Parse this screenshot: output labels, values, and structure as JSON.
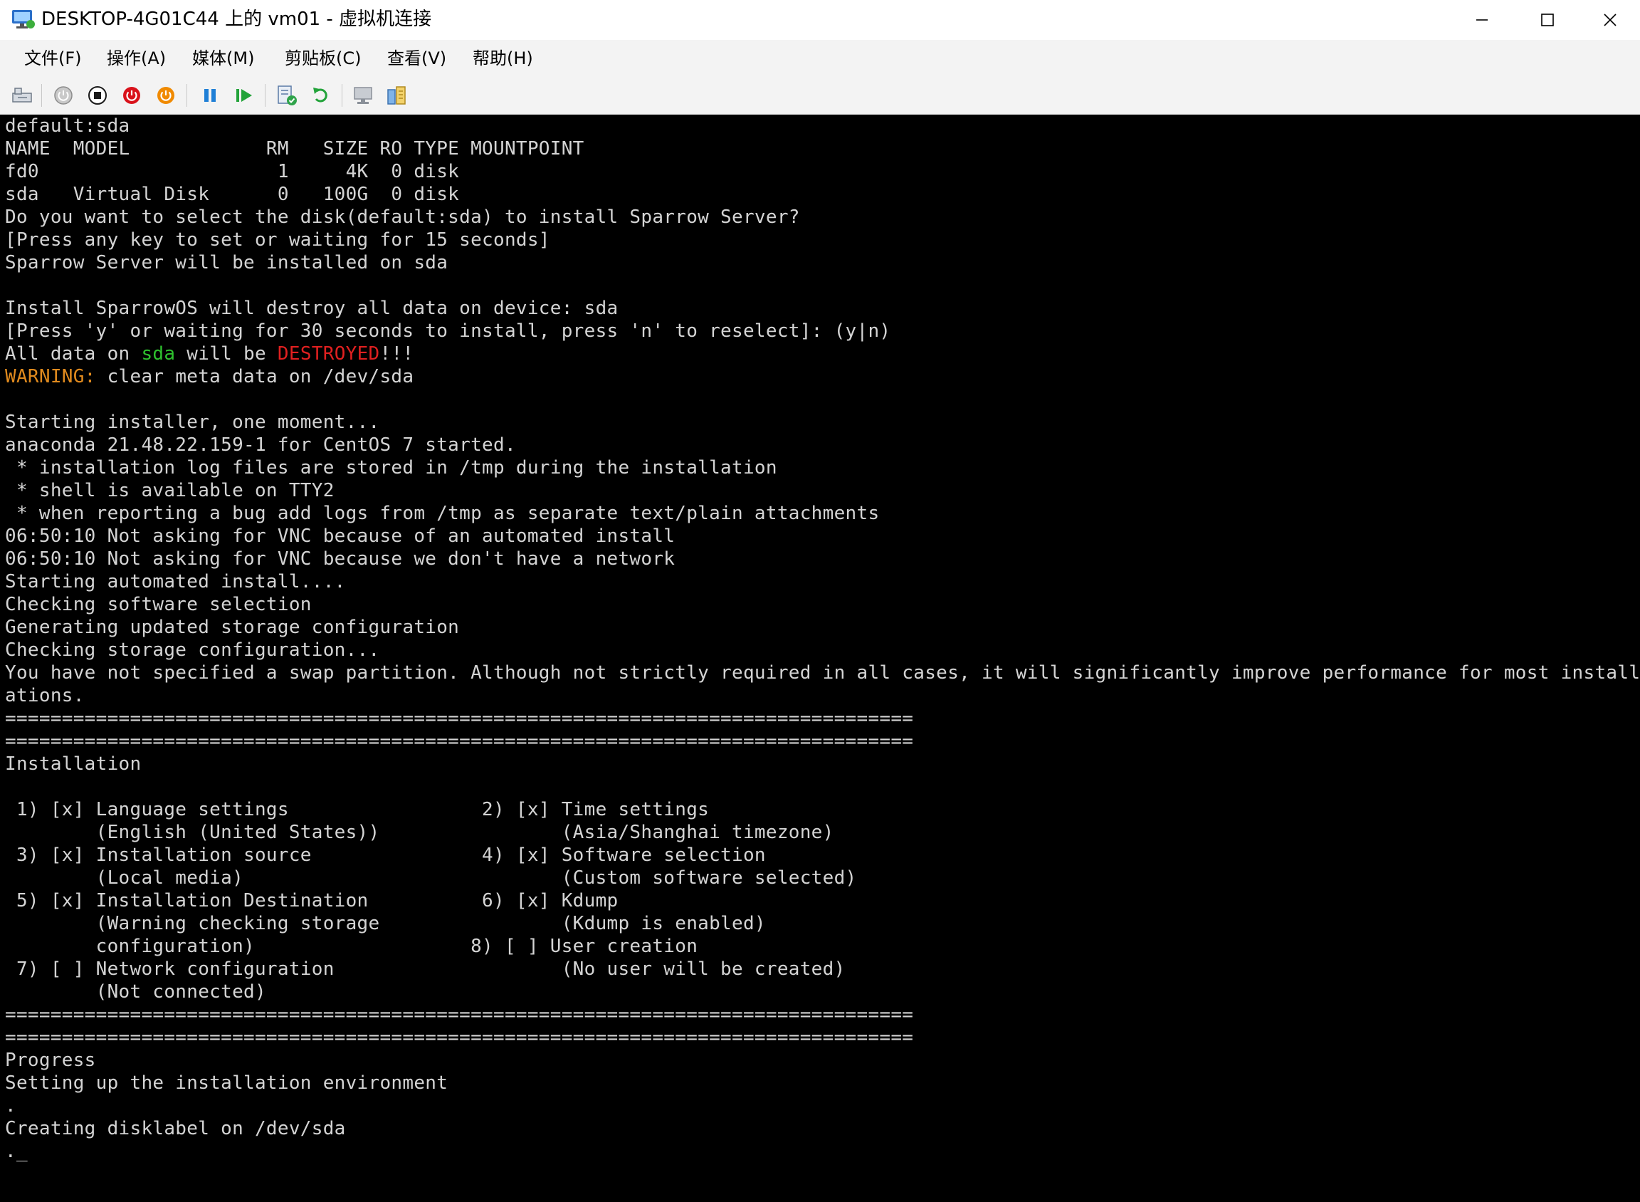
{
  "window": {
    "title": "DESKTOP-4G01C44 上的 vm01 - 虚拟机连接"
  },
  "menu": {
    "file": "文件(F)",
    "action": "操作(A)",
    "media": "媒体(M)",
    "clipboard": "剪贴板(C)",
    "view": "查看(V)",
    "help": "帮助(H)"
  },
  "toolbar": {
    "icons": [
      "ctrl-alt-del-icon",
      "start-icon",
      "turn-off-icon",
      "shutdown-icon",
      "power-icon",
      "pause-icon",
      "resume-icon",
      "checkpoint-icon",
      "revert-icon",
      "enhanced-session-icon",
      "share-icon"
    ]
  },
  "colors": {
    "console_text": "#d4d4d4",
    "green": "#2ec22e",
    "red": "#e02020",
    "orange": "#e08a1e"
  },
  "console": {
    "l01": "default:sda",
    "l02": "NAME  MODEL            RM   SIZE RO TYPE MOUNTPOINT",
    "l03": "fd0                     1     4K  0 disk",
    "l04": "sda   Virtual Disk      0   100G  0 disk",
    "l05": "Do you want to select the disk(default:sda) to install Sparrow Server?",
    "l06": "[Press any key to set or waiting for 15 seconds]",
    "l07": "Sparrow Server will be installed on sda",
    "l08": "",
    "l09": "Install SparrowOS will destroy all data on device: sda",
    "l10": "[Press 'y' or waiting for 30 seconds to install, press 'n' to reselect]: (y|n)",
    "l11a": "All data on ",
    "l11b": "sda",
    "l11c": " will be ",
    "l11d": "DESTROYED",
    "l11e": "!!!",
    "l12a": "WARNING:",
    "l12b": " clear meta data on /dev/sda",
    "l13": "",
    "l14": "Starting installer, one moment...",
    "l15": "anaconda 21.48.22.159-1 for CentOS 7 started.",
    "l16": " * installation log files are stored in /tmp during the installation",
    "l17": " * shell is available on TTY2",
    "l18": " * when reporting a bug add logs from /tmp as separate text/plain attachments",
    "l19": "06:50:10 Not asking for VNC because of an automated install",
    "l20": "06:50:10 Not asking for VNC because we don't have a network",
    "l21": "Starting automated install....",
    "l22": "Checking software selection",
    "l23": "Generating updated storage configuration",
    "l24": "Checking storage configuration...",
    "l25": "You have not specified a swap partition. Although not strictly required in all cases, it will significantly improve performance for most install",
    "l26": "ations.",
    "l27": "================================================================================",
    "l28": "================================================================================",
    "l29": "Installation",
    "l30": "",
    "l31": " 1) [x] Language settings                 2) [x] Time settings",
    "l32": "        (English (United States))                (Asia/Shanghai timezone)",
    "l33": " 3) [x] Installation source               4) [x] Software selection",
    "l34": "        (Local media)                            (Custom software selected)",
    "l35": " 5) [x] Installation Destination          6) [x] Kdump",
    "l36": "        (Warning checking storage                (Kdump is enabled)",
    "l37": "        configuration)                   8) [ ] User creation",
    "l38": " 7) [ ] Network configuration                    (No user will be created)",
    "l39": "        (Not connected)",
    "l40": "================================================================================",
    "l41": "================================================================================",
    "l42": "Progress",
    "l43": "Setting up the installation environment",
    "l44": ".",
    "l45": "Creating disklabel on /dev/sda",
    "l46": "._"
  }
}
